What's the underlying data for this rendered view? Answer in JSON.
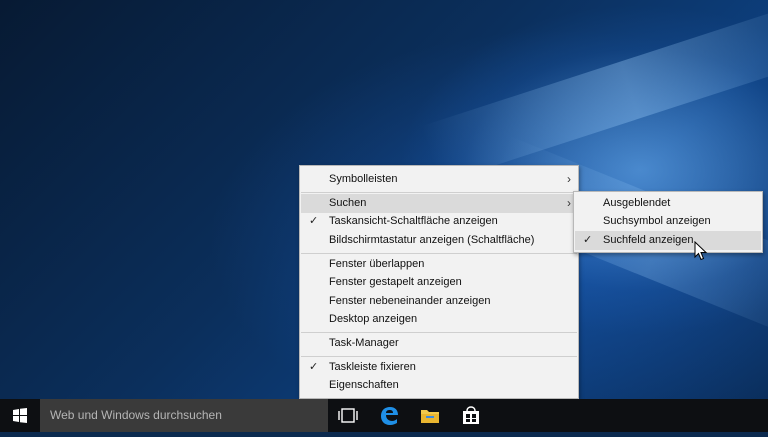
{
  "colors": {
    "taskbar": "#0d0f12",
    "menu_bg": "#f2f2f2",
    "highlight": "#dadada",
    "search_bg": "#3a3a3a"
  },
  "main_menu": {
    "items": [
      {
        "label": "Symbolleisten",
        "has_submenu": true
      },
      {
        "label": "Suchen",
        "has_submenu": true,
        "highlighted": true
      },
      {
        "label": "Taskansicht-Schaltfläche anzeigen",
        "checked": true
      },
      {
        "label": "Bildschirmtastatur anzeigen (Schaltfläche)"
      },
      {
        "label": "Fenster überlappen"
      },
      {
        "label": "Fenster gestapelt anzeigen"
      },
      {
        "label": "Fenster nebeneinander anzeigen"
      },
      {
        "label": "Desktop anzeigen"
      },
      {
        "label": "Task-Manager"
      },
      {
        "label": "Taskleiste fixieren",
        "checked": true
      },
      {
        "label": "Eigenschaften"
      }
    ]
  },
  "sub_menu": {
    "items": [
      {
        "label": "Ausgeblendet"
      },
      {
        "label": "Suchsymbol anzeigen"
      },
      {
        "label": "Suchfeld anzeigen",
        "checked": true,
        "highlighted": true
      }
    ]
  },
  "symbols": {
    "check": "✓",
    "submenu_arrow": "›"
  },
  "taskbar": {
    "search_placeholder": "Web und Windows durchsuchen",
    "icons": [
      "windows-start-icon",
      "task-view-icon",
      "edge-icon",
      "file-explorer-icon",
      "store-icon"
    ]
  }
}
